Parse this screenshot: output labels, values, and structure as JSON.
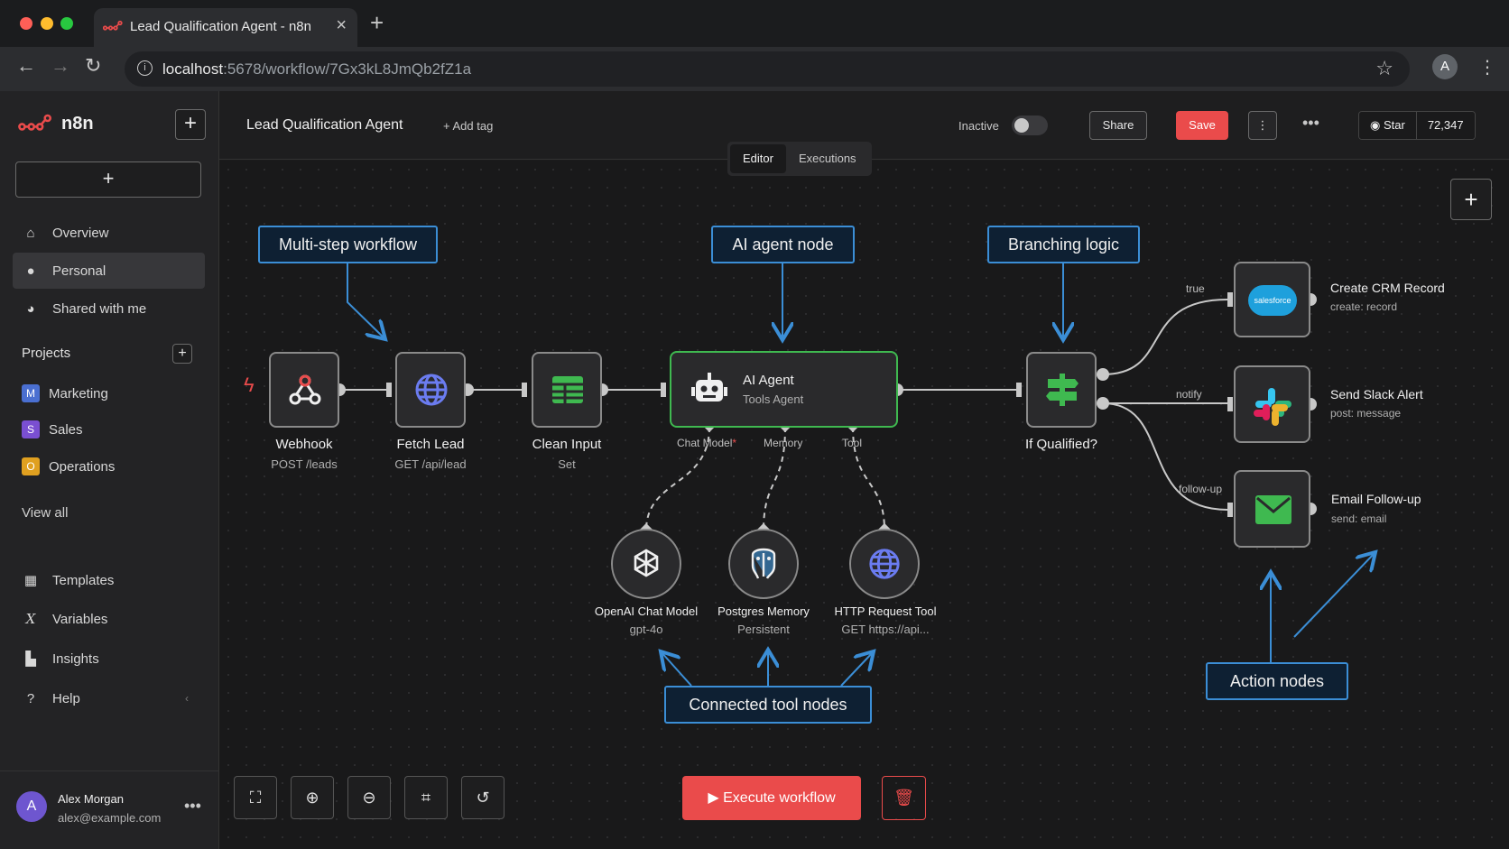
{
  "browser": {
    "tab_title": "Lead Qualification Agent - n8n",
    "url_host": "localhost",
    "url_rest": ":5678/workflow/7Gx3kL8JmQb2fZ1a",
    "profile_initial": "A"
  },
  "sidebar": {
    "brand": "n8n",
    "nav": [
      {
        "label": "Overview",
        "icon": "home-icon"
      },
      {
        "label": "Personal",
        "icon": "user-icon",
        "active": true
      },
      {
        "label": "Shared with me",
        "icon": "users-icon"
      }
    ],
    "projects_label": "Projects",
    "projects": [
      {
        "label": "Marketing",
        "badge": "M",
        "color": "#4a6fd1"
      },
      {
        "label": "Sales",
        "badge": "S",
        "color": "#7a4fd1"
      },
      {
        "label": "Operations",
        "badge": "O",
        "color": "#e0a020"
      }
    ],
    "view_all": "View all",
    "bottom_nav": [
      {
        "label": "Templates",
        "icon": "templates-icon"
      },
      {
        "label": "Variables",
        "icon": "variables-icon"
      },
      {
        "label": "Insights",
        "icon": "insights-icon"
      },
      {
        "label": "Help",
        "icon": "help-icon"
      }
    ],
    "user": {
      "initial": "A",
      "name": "Alex Morgan",
      "email": "alex@example.com"
    }
  },
  "header": {
    "workflow_name": "Lead Qualification Agent",
    "add_tag": "+ Add tag",
    "status": "Inactive",
    "share": "Share",
    "save": "Save",
    "github_star": "Star",
    "github_count": "72,347",
    "tabs": [
      "Editor",
      "Executions"
    ]
  },
  "nodes": {
    "webhook": {
      "label": "Webhook",
      "sub": "POST /leads"
    },
    "fetch": {
      "label": "Fetch Lead",
      "sub": "GET /api/lead"
    },
    "clean": {
      "label": "Clean Input",
      "sub": "Set"
    },
    "agent": {
      "label": "AI Agent",
      "sub": "Tools Agent",
      "ports": [
        "Chat Model",
        "*",
        "Memory",
        "Tool"
      ]
    },
    "ifq": {
      "label": "If Qualified?"
    },
    "openai": {
      "label": "OpenAI Chat Model",
      "sub": "gpt-4o"
    },
    "postgres": {
      "label": "Postgres Memory",
      "sub": "Persistent"
    },
    "http": {
      "label": "HTTP Request Tool",
      "sub": "GET https://api..."
    },
    "crm": {
      "label": "Create CRM Record",
      "sub": "create: record",
      "logo_text": "salesforce"
    },
    "slack": {
      "label": "Send Slack Alert",
      "sub": "post: message"
    },
    "email": {
      "label": "Email Follow-up",
      "sub": "send: email"
    }
  },
  "branches": [
    "true",
    "notify",
    "follow-up"
  ],
  "callouts": {
    "multistep": "Multi-step workflow",
    "agent": "AI agent node",
    "branching": "Branching logic",
    "tools": "Connected tool nodes",
    "actions": "Action nodes"
  },
  "controls": {
    "execute": "Execute workflow"
  },
  "colors": {
    "accent": "#ea4b4b",
    "callout_border": "#3b8ed6",
    "agent_border": "#3fb950"
  }
}
